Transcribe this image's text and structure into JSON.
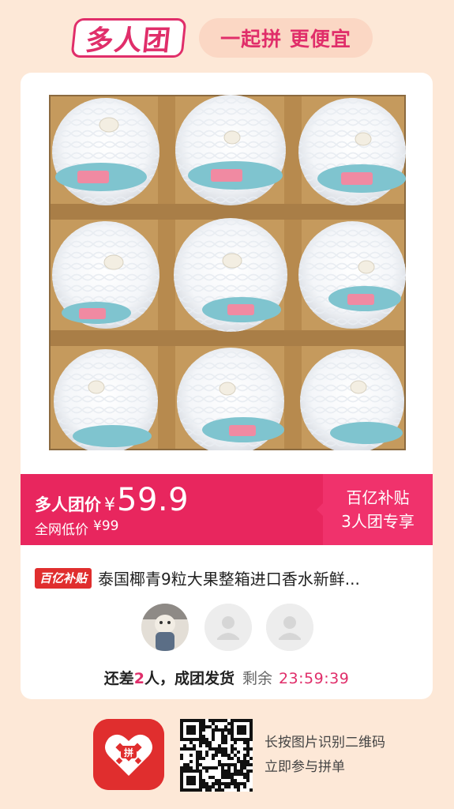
{
  "header": {
    "brand": "多人团",
    "slogan": "一起拼 更便宜"
  },
  "price_bar": {
    "label": "多人团价",
    "currency": "¥",
    "price": "59.9",
    "original_label": "全网低价",
    "original_price": "¥99",
    "subsidy_title": "百亿补贴",
    "subsidy_sub": "3人团专享"
  },
  "product": {
    "tag": "百亿补贴",
    "title": "泰国椰青9粒大果整箱进口香水新鲜..."
  },
  "group_status": {
    "prefix": "还差",
    "count": "2",
    "suffix": "人，成团发货",
    "remain_label": "剩余",
    "countdown": "23:59:39"
  },
  "footer": {
    "line1": "长按图片识别二维码",
    "line2": "立即参与拼单"
  },
  "colors": {
    "accent": "#e02e6a",
    "price_bar": "#e8265e",
    "background": "#fde8d7"
  },
  "icons": {
    "avatar_placeholder": "person-silhouette-icon",
    "app_logo": "pinduoduo-logo",
    "qr": "qr-code"
  }
}
